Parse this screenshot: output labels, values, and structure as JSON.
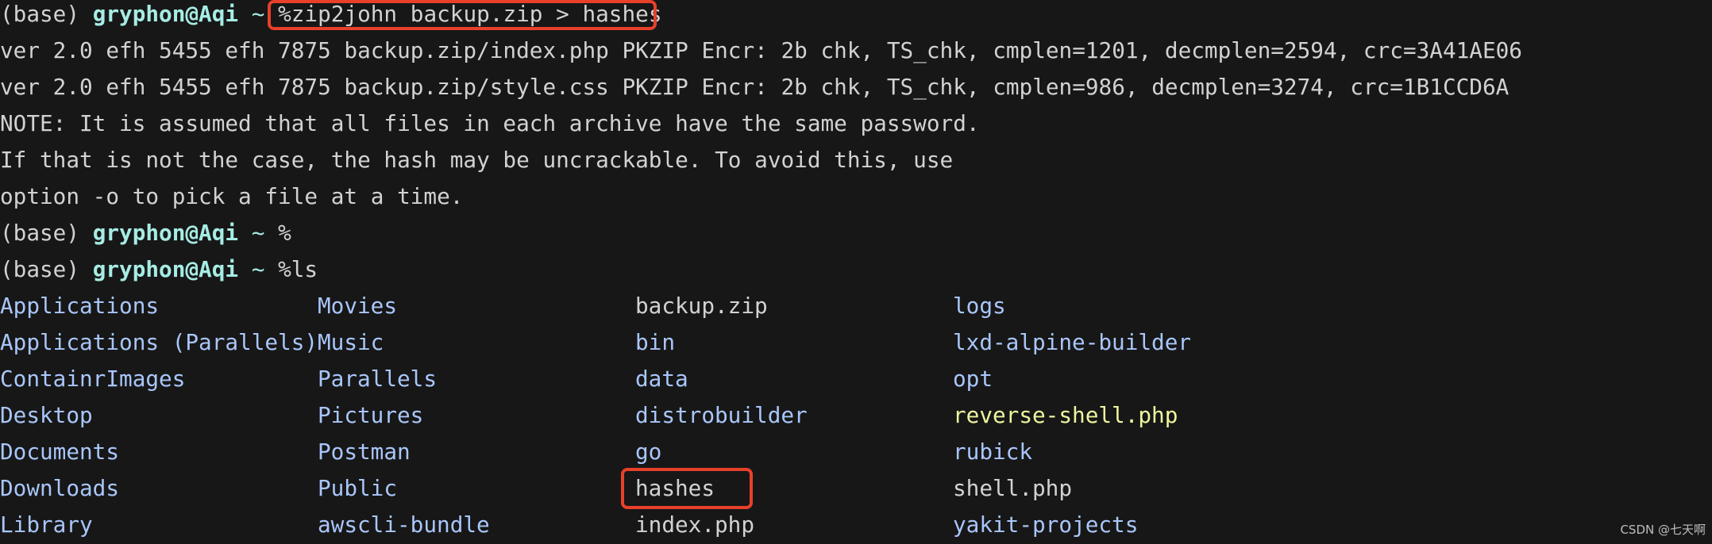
{
  "prompt": {
    "env": "(base) ",
    "user": "gryphon@Aqi",
    "tilde": " ~ "
  },
  "lines": {
    "cmd1": "%zip2john backup.zip > hashes",
    "out1": "ver 2.0 efh 5455 efh 7875 backup.zip/index.php PKZIP Encr: 2b chk, TS_chk, cmplen=1201, decmplen=2594, crc=3A41AE06",
    "out2": "ver 2.0 efh 5455 efh 7875 backup.zip/style.css PKZIP Encr: 2b chk, TS_chk, cmplen=986, decmplen=3274, crc=1B1CCD6A",
    "out3": "NOTE: It is assumed that all files in each archive have the same password.",
    "out4": "If that is not the case, the hash may be uncrackable. To avoid this, use",
    "out5": "option -o to pick a file at a time.",
    "cmd2": "%",
    "cmd3": "%ls"
  },
  "ls": [
    {
      "name": "Applications",
      "type": "dir"
    },
    {
      "name": "Movies",
      "type": "dir"
    },
    {
      "name": "backup.zip",
      "type": "file"
    },
    {
      "name": "logs",
      "type": "dir"
    },
    {
      "name": "Applications (Parallels)",
      "type": "dir"
    },
    {
      "name": "Music",
      "type": "dir"
    },
    {
      "name": "bin",
      "type": "dir"
    },
    {
      "name": "lxd-alpine-builder",
      "type": "dir"
    },
    {
      "name": "ContainrImages",
      "type": "dir"
    },
    {
      "name": "Parallels",
      "type": "dir"
    },
    {
      "name": "data",
      "type": "dir"
    },
    {
      "name": "opt",
      "type": "dir"
    },
    {
      "name": "Desktop",
      "type": "dir"
    },
    {
      "name": "Pictures",
      "type": "dir"
    },
    {
      "name": "distrobuilder",
      "type": "dir"
    },
    {
      "name": "reverse-shell.php",
      "type": "exec"
    },
    {
      "name": "Documents",
      "type": "dir"
    },
    {
      "name": "Postman",
      "type": "dir"
    },
    {
      "name": "go",
      "type": "dir"
    },
    {
      "name": "rubick",
      "type": "dir"
    },
    {
      "name": "Downloads",
      "type": "dir"
    },
    {
      "name": "Public",
      "type": "dir"
    },
    {
      "name": "hashes",
      "type": "file"
    },
    {
      "name": "shell.php",
      "type": "file"
    },
    {
      "name": "Library",
      "type": "dir"
    },
    {
      "name": "awscli-bundle",
      "type": "dir"
    },
    {
      "name": "index.php",
      "type": "file"
    },
    {
      "name": "yakit-projects",
      "type": "dir"
    }
  ],
  "colors": {
    "background": "#171717",
    "text": "#d2d2d2",
    "user": "#a6ece4",
    "directory": "#a9c6fa",
    "executable": "#eef59e",
    "highlight": "#e8402a"
  },
  "watermark": "CSDN @七天啊"
}
